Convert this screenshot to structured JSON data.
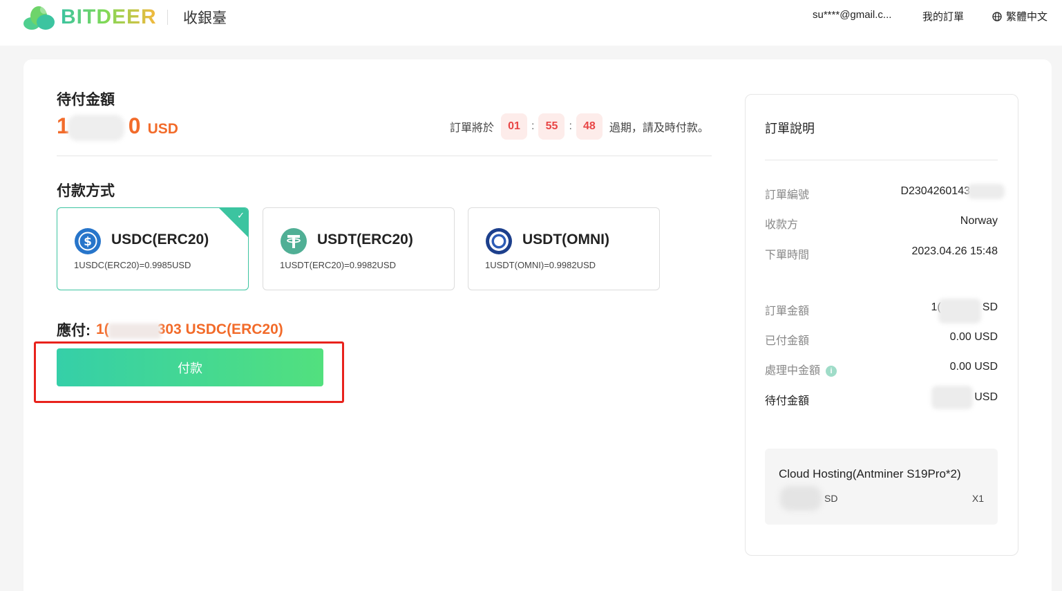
{
  "header": {
    "brand": "BITDEER",
    "section_title": "收銀臺",
    "user_email": "su****@gmail.c...",
    "my_orders": "我的訂單",
    "language": "繁體中文"
  },
  "payment": {
    "pending_label": "待付金額",
    "amount_visible_start": "1",
    "amount_visible_end": "0",
    "amount_unit": "USD",
    "timer_prefix": "訂單將於",
    "timer_hours": "01",
    "timer_minutes": "55",
    "timer_seconds": "48",
    "timer_suffix": "過期，請及時付款。",
    "method_label": "付款方式",
    "methods": [
      {
        "name": "USDC(ERC20)",
        "rate": "1USDC(ERC20)=0.9985USD",
        "selected": true,
        "icon": "usdc-icon"
      },
      {
        "name": "USDT(ERC20)",
        "rate": "1USDT(ERC20)=0.9982USD",
        "selected": false,
        "icon": "tether-icon"
      },
      {
        "name": "USDT(OMNI)",
        "rate": "1USDT(OMNI)=0.9982USD",
        "selected": false,
        "icon": "omni-icon"
      }
    ],
    "due_label": "應付:",
    "due_start": "1(",
    "due_end": "303 USDC(ERC20)",
    "pay_button": "付款"
  },
  "order": {
    "title": "訂單說明",
    "rows": [
      {
        "label": "訂單編號",
        "value": "D2304260143"
      },
      {
        "label": "收款方",
        "value": "Norway"
      },
      {
        "label": "下單時間",
        "value": "2023.04.26 15:48"
      },
      {
        "label": "訂單金額",
        "value_start": "1(",
        "value_end": "SD"
      },
      {
        "label": "已付金額",
        "value": "0.00 USD"
      },
      {
        "label": "處理中金額",
        "value": "0.00 USD"
      },
      {
        "label": "待付金額",
        "value": "USD"
      }
    ],
    "product": {
      "name": "Cloud Hosting(Antminer S19Pro*2)",
      "price_suffix": "SD",
      "quantity": "X1"
    }
  },
  "colors": {
    "accent": "#3cc4a0",
    "amount": "#f26b2a",
    "highlight": "#e8221c"
  }
}
